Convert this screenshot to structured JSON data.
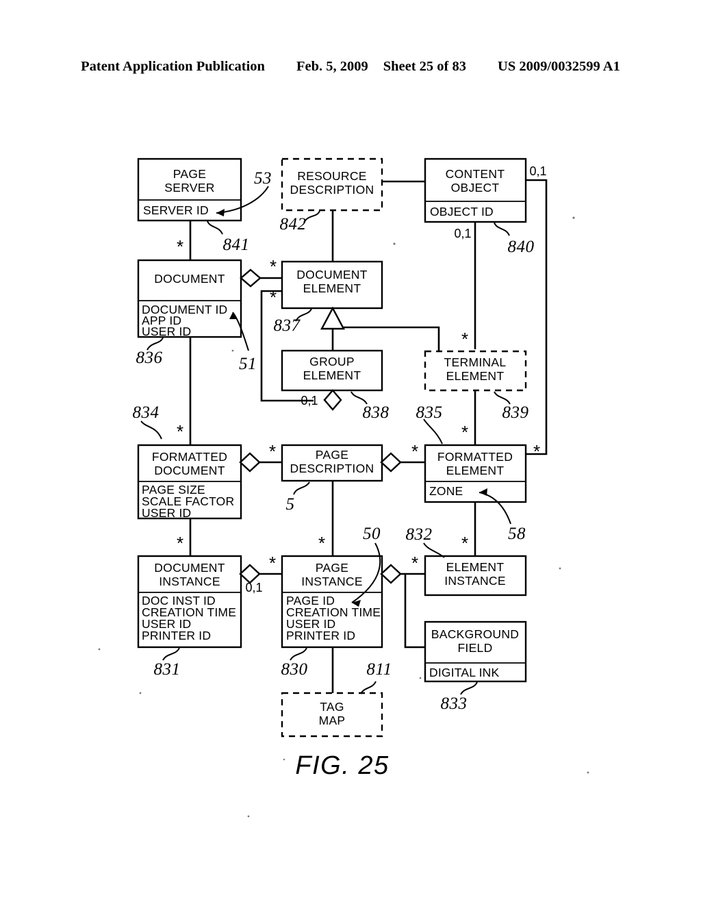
{
  "header": {
    "publication": "Patent Application Publication",
    "date": "Feb. 5, 2009",
    "sheet": "Sheet 25 of 83",
    "patent_number": "US 2009/0032599 A1"
  },
  "figure": {
    "label": "FIG. 25",
    "type": "uml-class-diagram"
  },
  "classes": [
    {
      "id": "page-server",
      "name": "PAGE\nSERVER",
      "name_lines": [
        "PAGE",
        "SERVER"
      ],
      "attributes": [
        "SERVER ID"
      ],
      "style": "solid",
      "ref": "841"
    },
    {
      "id": "resource-description",
      "name_lines": [
        "RESOURCE",
        "DESCRIPTION"
      ],
      "attributes": [],
      "style": "dashed",
      "ref": "842"
    },
    {
      "id": "content-object",
      "name_lines": [
        "CONTENT",
        "OBJECT"
      ],
      "attributes": [
        "OBJECT ID"
      ],
      "style": "solid",
      "ref": "840"
    },
    {
      "id": "document",
      "name_lines": [
        "DOCUMENT"
      ],
      "attributes": [
        "DOCUMENT ID",
        "APP ID",
        "USER ID"
      ],
      "style": "solid",
      "ref": "836"
    },
    {
      "id": "document-element",
      "name_lines": [
        "DOCUMENT",
        "ELEMENT"
      ],
      "attributes": [],
      "style": "solid",
      "ref": "837"
    },
    {
      "id": "group-element",
      "name_lines": [
        "GROUP",
        "ELEMENT"
      ],
      "attributes": [],
      "style": "solid",
      "ref": "838"
    },
    {
      "id": "terminal-element",
      "name_lines": [
        "TERMINAL",
        "ELEMENT"
      ],
      "attributes": [],
      "style": "dashed",
      "ref": "839"
    },
    {
      "id": "formatted-document",
      "name_lines": [
        "FORMATTED",
        "DOCUMENT"
      ],
      "attributes": [
        "PAGE SIZE",
        "SCALE FACTOR",
        "USER ID"
      ],
      "style": "solid",
      "ref": "834"
    },
    {
      "id": "page-description",
      "name_lines": [
        "PAGE",
        "DESCRIPTION"
      ],
      "attributes": [],
      "style": "solid",
      "ref": "5"
    },
    {
      "id": "formatted-element",
      "name_lines": [
        "FORMATTED",
        "ELEMENT"
      ],
      "attributes": [
        "ZONE"
      ],
      "style": "solid",
      "ref": "835"
    },
    {
      "id": "document-instance",
      "name_lines": [
        "DOCUMENT",
        "INSTANCE"
      ],
      "attributes": [
        "DOC INST ID",
        "CREATION TIME",
        "USER ID",
        "PRINTER ID"
      ],
      "style": "solid",
      "ref": "831"
    },
    {
      "id": "page-instance",
      "name_lines": [
        "PAGE",
        "INSTANCE"
      ],
      "attributes": [
        "PAGE ID",
        "CREATION TIME",
        "USER ID",
        "PRINTER ID"
      ],
      "style": "solid",
      "ref": "830"
    },
    {
      "id": "element-instance",
      "name_lines": [
        "ELEMENT",
        "INSTANCE"
      ],
      "attributes": [],
      "style": "solid",
      "ref": "832"
    },
    {
      "id": "background-field",
      "name_lines": [
        "BACKGROUND",
        "FIELD"
      ],
      "attributes": [
        "DIGITAL INK"
      ],
      "style": "solid",
      "ref": "833"
    },
    {
      "id": "tag-map",
      "name_lines": [
        "TAG",
        "MAP"
      ],
      "attributes": [],
      "style": "dashed",
      "ref": "811"
    }
  ],
  "reference_numerals": [
    {
      "value": "53",
      "points_to": "SERVER ID"
    },
    {
      "value": "841",
      "points_to": "page-server"
    },
    {
      "value": "842",
      "points_to": "resource-description"
    },
    {
      "value": "840",
      "points_to": "content-object"
    },
    {
      "value": "836",
      "points_to": "document"
    },
    {
      "value": "51",
      "points_to": "DOCUMENT ID"
    },
    {
      "value": "837",
      "points_to": "document-element"
    },
    {
      "value": "838",
      "points_to": "group-element"
    },
    {
      "value": "835",
      "points_to": "formatted-element"
    },
    {
      "value": "839",
      "points_to": "terminal-element"
    },
    {
      "value": "834",
      "points_to": "formatted-document"
    },
    {
      "value": "5",
      "points_to": "page-description"
    },
    {
      "value": "58",
      "points_to": "ZONE"
    },
    {
      "value": "50",
      "points_to": "PAGE ID"
    },
    {
      "value": "832",
      "points_to": "element-instance"
    },
    {
      "value": "831",
      "points_to": "document-instance"
    },
    {
      "value": "830",
      "points_to": "page-instance"
    },
    {
      "value": "811",
      "points_to": "tag-map"
    },
    {
      "value": "833",
      "points_to": "background-field"
    }
  ],
  "multiplicities": [
    {
      "label": "*",
      "near": "document-top"
    },
    {
      "label": "*",
      "near": "document-element-left-upper"
    },
    {
      "label": "*",
      "near": "document-element-left-lower"
    },
    {
      "label": "0,1",
      "near": "content-object-right"
    },
    {
      "label": "0,1",
      "near": "content-object-bottom"
    },
    {
      "label": "*",
      "near": "terminal-element-top"
    },
    {
      "label": "0,1",
      "near": "group-element-bottom"
    },
    {
      "label": "*",
      "near": "formatted-document-top"
    },
    {
      "label": "*",
      "near": "page-description-left"
    },
    {
      "label": "*",
      "near": "formatted-element-left"
    },
    {
      "label": "*",
      "near": "formatted-element-top"
    },
    {
      "label": "*",
      "near": "formatted-element-right"
    },
    {
      "label": "*",
      "near": "document-instance-top"
    },
    {
      "label": "0,1",
      "near": "document-instance-right"
    },
    {
      "label": "*",
      "near": "page-instance-left"
    },
    {
      "label": "*",
      "near": "page-instance-top"
    },
    {
      "label": "*",
      "near": "element-instance-left"
    },
    {
      "label": "*",
      "near": "element-instance-top"
    }
  ],
  "colors": {
    "ink": "#000000",
    "paper": "#ffffff"
  }
}
